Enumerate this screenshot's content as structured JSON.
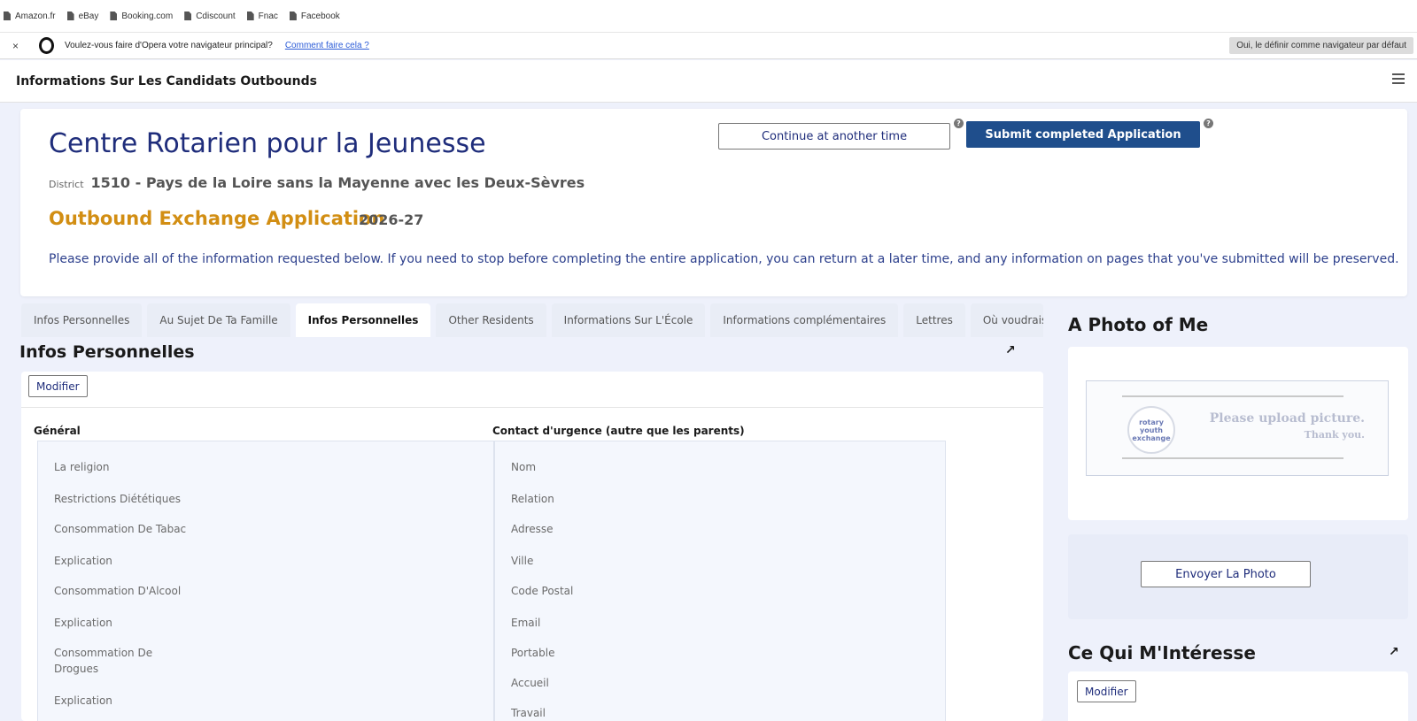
{
  "bookmarks": [
    "Amazon.fr",
    "eBay",
    "Booking.com",
    "Cdiscount",
    "Fnac",
    "Facebook"
  ],
  "opera_bar": {
    "close": "×",
    "message": "Voulez-vous faire d'Opera votre navigateur principal?",
    "link": "Comment faire cela ?",
    "default_button": "Oui, le définir comme navigateur par défaut"
  },
  "app": {
    "title": "Informations Sur Les Candidats Outbounds"
  },
  "header": {
    "org_name": "Centre Rotarien pour la Jeunesse",
    "district_label": "District",
    "district_value": "1510 - Pays de la Loire sans la Mayenne avec les Deux-Sèvres",
    "application_type": "Outbound Exchange Application",
    "year": "2026-27",
    "intro": "Please provide all of the information requested below. If you need to stop before completing the entire application, you can return at a later time, and any information on pages that you've submitted will be preserved.",
    "continue_label": "Continue at another time",
    "submit_label": "Submit completed Application",
    "help_glyph": "?"
  },
  "tabs": [
    "Infos Personnelles",
    "Au Sujet De Ta Famille",
    "Infos Personnelles",
    "Other Residents",
    "Informations Sur L'École",
    "Informations complémentaires",
    "Lettres",
    "Où voudrais-"
  ],
  "section": {
    "title": "Infos Personnelles",
    "edit_label": "Modifier",
    "expand_glyph": "↗",
    "general": {
      "heading": "Général",
      "fields": [
        "La religion",
        "Restrictions Diététiques",
        "Consommation De Tabac",
        "Explication",
        "Consommation D'Alcool",
        "Explication",
        "Consommation De Drogues",
        "Explication"
      ]
    },
    "emergency": {
      "heading": "Contact d'urgence (autre que les parents)",
      "fields": [
        "Nom",
        "Relation",
        "Adresse",
        "Ville",
        "Code Postal",
        "Email",
        "Portable",
        "Accueil",
        "Travail"
      ]
    }
  },
  "photo": {
    "title": "A Photo of Me",
    "placeholder_line1": "Please upload picture.",
    "placeholder_line2": "Thank you.",
    "logo_text": "rotary youth exchange",
    "upload_label": "Envoyer La Photo"
  },
  "interests": {
    "title": "Ce Qui M'Intéresse",
    "edit_label": "Modifier",
    "expand_glyph": "↗"
  },
  "colors": {
    "brand": "#1f2d7b",
    "accent": "#d28e13",
    "submit": "#1f4e8c"
  }
}
